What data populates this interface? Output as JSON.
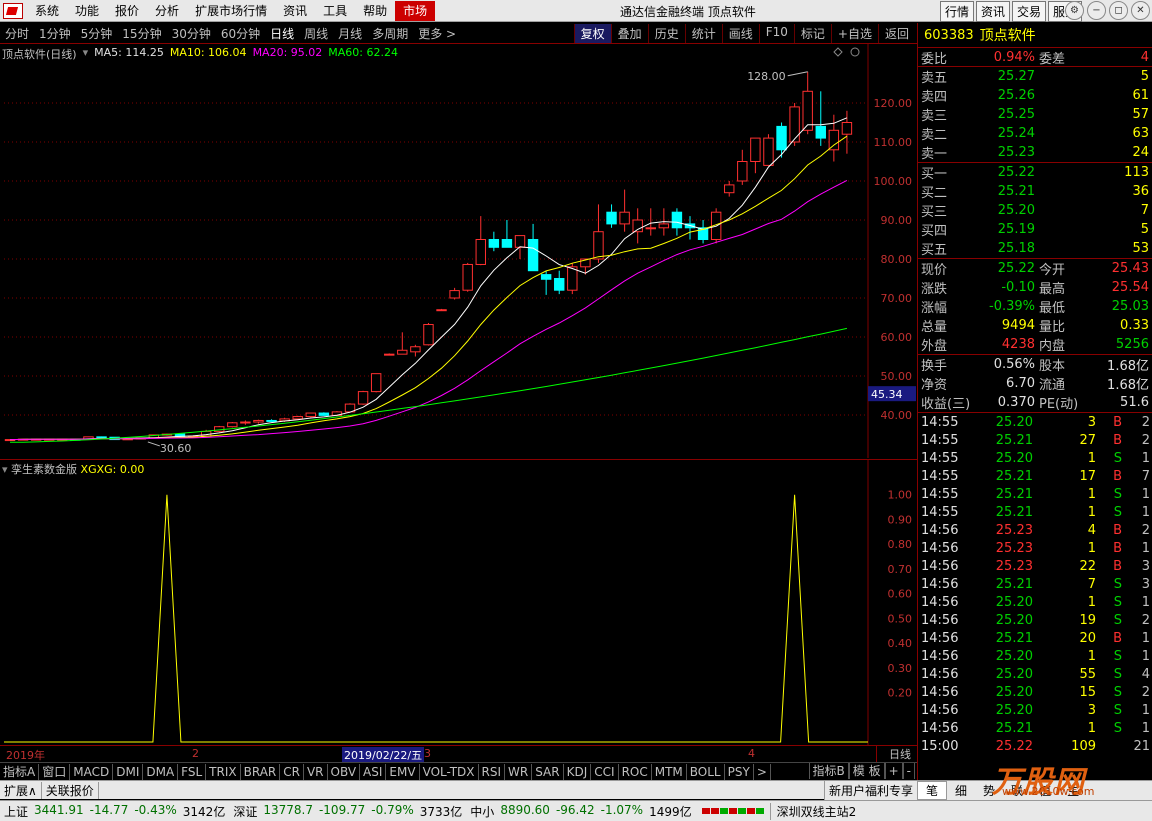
{
  "menu": {
    "items": [
      "系统",
      "功能",
      "报价",
      "分析",
      "扩展市场行情",
      "资讯",
      "工具",
      "帮助"
    ],
    "active": "市场",
    "title": "通达信金融终端  顶点软件",
    "right_buttons": [
      "行情",
      "资讯",
      "交易",
      "服务"
    ]
  },
  "periods": {
    "items": [
      "分时",
      "1分钟",
      "5分钟",
      "15分钟",
      "30分钟",
      "60分钟",
      "日线",
      "周线",
      "月线",
      "多周期",
      "更多 >"
    ],
    "selected": "日线",
    "tools": [
      "复权",
      "叠加",
      "历史",
      "统计",
      "画线",
      "F10",
      "标记",
      "+自选",
      "返回"
    ],
    "tools_on": "复权"
  },
  "main_info": {
    "name": "顶点软件(日线)",
    "ma5": "MA5: 114.25",
    "ma10": "MA10: 106.04",
    "ma20": "MA20: 95.02",
    "ma60": "MA60: 62.24",
    "high_label": "128.00",
    "low_label": "30.60",
    "price_tag": "45.34"
  },
  "sub_info": {
    "name": "孪生素数金版",
    "xgxg": "XGXG: 0.00"
  },
  "date_bar": {
    "year": "2019年",
    "m2": "2",
    "current": "2019/02/22/五",
    "m3": "3",
    "m4": "4",
    "period": "日线"
  },
  "indicators": {
    "items": [
      "指标A",
      "窗口",
      "MACD",
      "DMI",
      "DMA",
      "FSL",
      "TRIX",
      "BRAR",
      "CR",
      "VR",
      "OBV",
      "ASI",
      "EMV",
      "VOL-TDX",
      "RSI",
      "WR",
      "SAR",
      "KDJ",
      "CCI",
      "ROC",
      "MTM",
      "BOLL",
      "PSY",
      ">"
    ],
    "right": [
      "指标B",
      "模 板",
      "+",
      "-"
    ]
  },
  "ext_row": {
    "items": [
      "扩展∧",
      "关联报价"
    ],
    "promo": "新用户福利专享"
  },
  "status": {
    "sh_name": "上证",
    "sh_val": "3441.91",
    "sh_chg": "-14.77",
    "sh_pct": "-0.43%",
    "sh_amt": "3142亿",
    "sz_name": "深证",
    "sz_val": "13778.7",
    "sz_chg": "-109.77",
    "sz_pct": "-0.79%",
    "sz_amt": "3733亿",
    "zx_name": "中小",
    "zx_val": "8890.60",
    "zx_chg": "-96.42",
    "zx_pct": "-1.07%",
    "zx_amt": "1499亿",
    "server": "深圳双线主站2"
  },
  "quote": {
    "code": "603383",
    "name": "顶点软件",
    "weibi_label": "委比",
    "weibi": "0.94%",
    "weicha_label": "委差",
    "weicha": "4",
    "asks": [
      {
        "label": "卖五",
        "price": "25.27",
        "vol": "5"
      },
      {
        "label": "卖四",
        "price": "25.26",
        "vol": "61"
      },
      {
        "label": "卖三",
        "price": "25.25",
        "vol": "57"
      },
      {
        "label": "卖二",
        "price": "25.24",
        "vol": "63"
      },
      {
        "label": "卖一",
        "price": "25.23",
        "vol": "24"
      }
    ],
    "bids": [
      {
        "label": "买一",
        "price": "25.22",
        "vol": "113"
      },
      {
        "label": "买二",
        "price": "25.21",
        "vol": "36"
      },
      {
        "label": "买三",
        "price": "25.20",
        "vol": "7"
      },
      {
        "label": "买四",
        "price": "25.19",
        "vol": "5"
      },
      {
        "label": "买五",
        "price": "25.18",
        "vol": "53"
      }
    ],
    "stats": [
      {
        "l1": "现价",
        "v1": "25.22",
        "c1": "green",
        "l2": "今开",
        "v2": "25.43",
        "c2": "red"
      },
      {
        "l1": "涨跌",
        "v1": "-0.10",
        "c1": "green",
        "l2": "最高",
        "v2": "25.54",
        "c2": "red"
      },
      {
        "l1": "涨幅",
        "v1": "-0.39%",
        "c1": "green",
        "l2": "最低",
        "v2": "25.03",
        "c2": "green"
      },
      {
        "l1": "总量",
        "v1": "9494",
        "c1": "yellow",
        "l2": "量比",
        "v2": "0.33",
        "c2": "yellow"
      },
      {
        "l1": "外盘",
        "v1": "4238",
        "c1": "red",
        "l2": "内盘",
        "v2": "5256",
        "c2": "green"
      }
    ],
    "stats2": [
      {
        "l1": "换手",
        "v1": "0.56%",
        "l2": "股本",
        "v2": "1.68亿"
      },
      {
        "l1": "净资",
        "v1": "6.70",
        "l2": "流通",
        "v2": "1.68亿"
      },
      {
        "l1": "收益(三)",
        "v1": "0.370",
        "l2": "PE(动)",
        "v2": "51.6"
      }
    ],
    "ticks": [
      {
        "t": "14:55",
        "p": "25.20",
        "v": "3",
        "bs": "B",
        "n": "2"
      },
      {
        "t": "14:55",
        "p": "25.21",
        "v": "27",
        "bs": "B",
        "n": "2"
      },
      {
        "t": "14:55",
        "p": "25.20",
        "v": "1",
        "bs": "S",
        "n": "1"
      },
      {
        "t": "14:55",
        "p": "25.21",
        "v": "17",
        "bs": "B",
        "n": "7"
      },
      {
        "t": "14:55",
        "p": "25.21",
        "v": "1",
        "bs": "S",
        "n": "1"
      },
      {
        "t": "14:55",
        "p": "25.21",
        "v": "1",
        "bs": "S",
        "n": "1"
      },
      {
        "t": "14:56",
        "p": "25.23",
        "v": "4",
        "bs": "B",
        "n": "2"
      },
      {
        "t": "14:56",
        "p": "25.23",
        "v": "1",
        "bs": "B",
        "n": "1"
      },
      {
        "t": "14:56",
        "p": "25.23",
        "v": "22",
        "bs": "B",
        "n": "3"
      },
      {
        "t": "14:56",
        "p": "25.21",
        "v": "7",
        "bs": "S",
        "n": "3"
      },
      {
        "t": "14:56",
        "p": "25.20",
        "v": "1",
        "bs": "S",
        "n": "1"
      },
      {
        "t": "14:56",
        "p": "25.20",
        "v": "19",
        "bs": "S",
        "n": "2"
      },
      {
        "t": "14:56",
        "p": "25.21",
        "v": "20",
        "bs": "B",
        "n": "1"
      },
      {
        "t": "14:56",
        "p": "25.20",
        "v": "1",
        "bs": "S",
        "n": "1"
      },
      {
        "t": "14:56",
        "p": "25.20",
        "v": "55",
        "bs": "S",
        "n": "4"
      },
      {
        "t": "14:56",
        "p": "25.20",
        "v": "15",
        "bs": "S",
        "n": "2"
      },
      {
        "t": "14:56",
        "p": "25.20",
        "v": "3",
        "bs": "S",
        "n": "1"
      },
      {
        "t": "14:56",
        "p": "25.21",
        "v": "1",
        "bs": "S",
        "n": "1"
      },
      {
        "t": "15:00",
        "p": "25.22",
        "v": "109",
        "bs": "",
        "n": "21"
      }
    ],
    "bottom_tabs": [
      "笔",
      "细",
      "势",
      "联",
      "值",
      "主"
    ]
  },
  "watermark": {
    "text": "万股网",
    "url": "www.2010w.com"
  },
  "colors": {
    "up": "#ff3030",
    "down": "#00ffff",
    "ma5": "#ffffff",
    "ma10": "#ffff00",
    "ma20": "#ff00ff",
    "ma60": "#00ff00",
    "grid": "#800000"
  },
  "chart_data": [
    {
      "type": "candlestick",
      "title": "顶点软件(日线)",
      "ylim": [
        30,
        130
      ],
      "yticks": [
        40,
        50,
        60,
        70,
        80,
        90,
        100,
        110,
        120
      ],
      "candles": [
        [
          33.6,
          33.7,
          33.6,
          33.7
        ],
        [
          33.7,
          33.8,
          33.6,
          33.8
        ],
        [
          33.8,
          33.9,
          33.7,
          33.8
        ],
        [
          33.8,
          33.9,
          33.7,
          33.8
        ],
        [
          33.8,
          33.9,
          33.7,
          33.8
        ],
        [
          33.8,
          33.9,
          33.6,
          33.7
        ],
        [
          33.7,
          34.5,
          33.7,
          34.4
        ],
        [
          34.4,
          34.5,
          34.2,
          34.3
        ],
        [
          34.3,
          34.3,
          33.6,
          33.7
        ],
        [
          33.7,
          34.0,
          33.6,
          33.9
        ],
        [
          33.9,
          34.2,
          33.8,
          34.1
        ],
        [
          34.1,
          35.0,
          34.0,
          34.9
        ],
        [
          34.9,
          35.2,
          34.7,
          35.1
        ],
        [
          35.1,
          35.1,
          34.4,
          34.5
        ],
        [
          34.5,
          34.8,
          34.3,
          34.6
        ],
        [
          34.6,
          36.2,
          34.5,
          35.8
        ],
        [
          35.8,
          37.2,
          35.6,
          37.0
        ],
        [
          37.0,
          38.2,
          36.8,
          38.0
        ],
        [
          38.0,
          38.6,
          37.5,
          38.2
        ],
        [
          38.2,
          38.8,
          37.8,
          38.6
        ],
        [
          38.6,
          38.9,
          38.3,
          38.5
        ],
        [
          38.5,
          39.3,
          38.2,
          39.0
        ],
        [
          39.0,
          39.8,
          38.8,
          39.6
        ],
        [
          39.6,
          40.6,
          39.4,
          40.5
        ],
        [
          40.5,
          40.7,
          39.8,
          39.9
        ],
        [
          39.9,
          41.0,
          39.7,
          40.8
        ],
        [
          40.8,
          43.0,
          40.6,
          42.8
        ],
        [
          42.8,
          46.2,
          42.6,
          46.0
        ],
        [
          46.0,
          50.6,
          45.8,
          50.6
        ],
        [
          55.6,
          55.8,
          55.4,
          55.6
        ],
        [
          55.6,
          61.2,
          55.6,
          56.6
        ],
        [
          56.2,
          58.0,
          55.0,
          57.5
        ],
        [
          58.0,
          63.6,
          57.8,
          63.2
        ],
        [
          67.0,
          67.2,
          66.8,
          67.0
        ],
        [
          70.0,
          72.6,
          69.6,
          71.9
        ],
        [
          72.0,
          79.0,
          71.6,
          78.6
        ],
        [
          78.6,
          91.0,
          78.4,
          85.0
        ],
        [
          85.0,
          87.0,
          82.0,
          83.0
        ],
        [
          85.0,
          90.0,
          84.0,
          83.0
        ],
        [
          83.0,
          86.0,
          80.0,
          86.0
        ],
        [
          85.0,
          89.0,
          80.0,
          77.0
        ],
        [
          76.0,
          77.0,
          70.8,
          74.8
        ],
        [
          75.0,
          77.0,
          71.0,
          72.0
        ],
        [
          72.0,
          79.0,
          71.0,
          78.0
        ],
        [
          78.0,
          80.0,
          76.0,
          80.0
        ],
        [
          80.0,
          94.0,
          79.0,
          87.0
        ],
        [
          92.0,
          94.0,
          88.0,
          89.0
        ],
        [
          89.0,
          97.8,
          87.0,
          92.0
        ],
        [
          87.0,
          93.0,
          84.0,
          90.0
        ],
        [
          88.0,
          93.0,
          86.0,
          88.0
        ],
        [
          88.0,
          93.0,
          86.0,
          89.0
        ],
        [
          92.0,
          93.0,
          86.0,
          88.0
        ],
        [
          89.0,
          91.0,
          85.0,
          88.0
        ],
        [
          88.0,
          90.0,
          84.0,
          85.0
        ],
        [
          85.0,
          93.0,
          84.0,
          92.0
        ],
        [
          97.0,
          100.0,
          96.0,
          99.0
        ],
        [
          100.0,
          108.0,
          99.0,
          105.0
        ],
        [
          105.0,
          108.0,
          102.0,
          111.0
        ],
        [
          104.0,
          112.0,
          104.0,
          111.0
        ],
        [
          114.0,
          115.0,
          106.0,
          108.0
        ],
        [
          110.0,
          120.0,
          109.0,
          119.0
        ],
        [
          113.0,
          128.0,
          112.0,
          123.0
        ],
        [
          114.0,
          123.0,
          109.0,
          111.0
        ],
        [
          108.0,
          117.0,
          105.0,
          113.0
        ],
        [
          112.0,
          118.0,
          107.0,
          115.0
        ]
      ],
      "ma_series": [
        {
          "name": "MA5"
        },
        {
          "name": "MA10"
        },
        {
          "name": "MA20"
        },
        {
          "name": "MA60"
        }
      ]
    },
    {
      "type": "line",
      "title": "孪生素数金版",
      "ylim": [
        0,
        1.1
      ],
      "yticks": [
        0.2,
        0.3,
        0.4,
        0.5,
        0.6,
        0.7,
        0.8,
        0.9,
        1.0
      ],
      "series": [
        {
          "name": "XGXG",
          "spikes_at_index": [
            12,
            60
          ],
          "value": 1.0
        }
      ]
    }
  ]
}
